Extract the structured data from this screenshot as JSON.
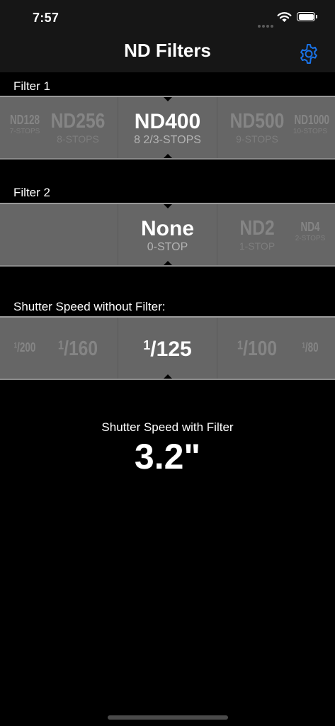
{
  "status_bar": {
    "time": "7:57"
  },
  "nav": {
    "title": "ND Filters",
    "settings_icon": "gear-icon",
    "accent_color": "#1a73e8"
  },
  "filter1": {
    "label": "Filter 1",
    "items": [
      {
        "name": "ND128",
        "stops": "7-STOPS"
      },
      {
        "name": "ND256",
        "stops": "8-STOPS"
      },
      {
        "name": "ND400",
        "stops": "8 2/3-STOPS"
      },
      {
        "name": "ND500",
        "stops": "9-STOPS"
      },
      {
        "name": "ND1000",
        "stops": "10-STOPS"
      }
    ],
    "selected_index": 2
  },
  "filter2": {
    "label": "Filter 2",
    "items": [
      {
        "name": "None",
        "stops": "0-STOP"
      },
      {
        "name": "ND2",
        "stops": "1-STOP"
      },
      {
        "name": "ND4",
        "stops": "2-STOPS"
      }
    ],
    "selected_index": 0
  },
  "shutter": {
    "label": "Shutter Speed without Filter:",
    "items": [
      {
        "num": "1",
        "den": "200"
      },
      {
        "num": "1",
        "den": "160"
      },
      {
        "num": "1",
        "den": "125"
      },
      {
        "num": "1",
        "den": "100"
      },
      {
        "num": "1",
        "den": "80"
      }
    ],
    "selected_index": 2
  },
  "result": {
    "label": "Shutter Speed with Filter",
    "value": "3.2\""
  }
}
